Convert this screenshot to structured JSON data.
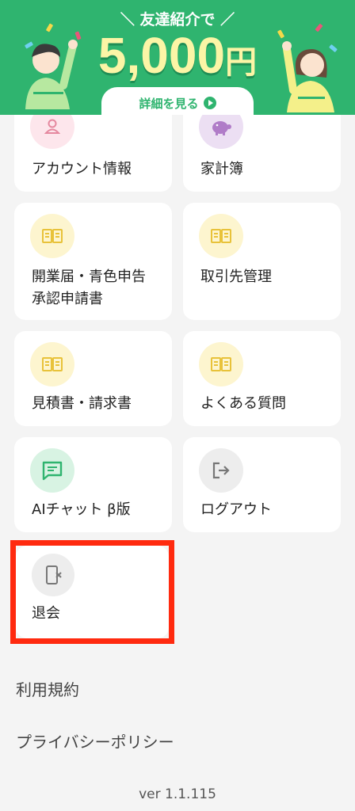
{
  "banner": {
    "subtitle": "友達紹介で",
    "amount": "5,000",
    "currency": "円",
    "link_label": "詳細を見る",
    "brand_color": "#2fb46f",
    "amount_color": "#fbf5a6"
  },
  "menu": {
    "items": [
      {
        "label": "アカウント情報",
        "icon": "person-icon"
      },
      {
        "label": "家計簿",
        "icon": "piggy-bank-icon"
      },
      {
        "label": "開業届・青色申告\n承認申請書",
        "icon": "book-icon"
      },
      {
        "label": "取引先管理",
        "icon": "book-icon"
      },
      {
        "label": "見積書・請求書",
        "icon": "book-icon"
      },
      {
        "label": "よくある質問",
        "icon": "book-icon"
      },
      {
        "label": "AIチャット β版",
        "icon": "chat-icon"
      },
      {
        "label": "ログアウト",
        "icon": "logout-icon"
      },
      {
        "label": "退会",
        "icon": "phone-x-icon"
      }
    ]
  },
  "footer": {
    "terms": "利用規約",
    "privacy": "プライバシーポリシー",
    "version": "ver 1.1.115"
  },
  "highlight_color": "#ff2a0f"
}
